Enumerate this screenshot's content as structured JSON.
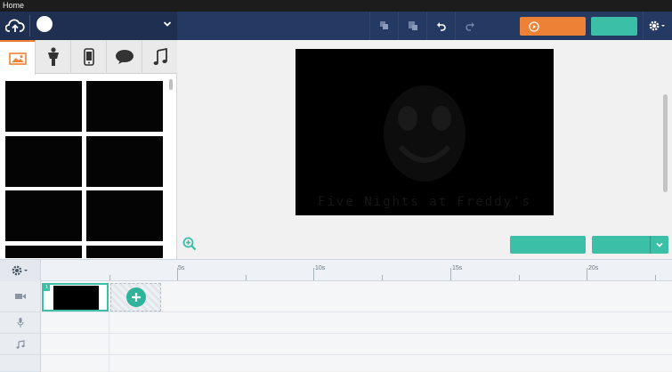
{
  "window": {
    "title": "Home"
  },
  "colors": {
    "navbar": "#253a63",
    "accent_orange": "#ed8136",
    "accent_teal": "#3bbfa7",
    "stage_bg": "#000000"
  },
  "navbar": {
    "upload_icon": "cloud-upload-icon",
    "tools": [
      {
        "name": "copy-icon"
      },
      {
        "name": "paste-icon"
      },
      {
        "name": "undo-icon"
      },
      {
        "name": "redo-icon"
      }
    ],
    "preview_label": "",
    "publish_label": "",
    "settings_icon": "gear-icon"
  },
  "library": {
    "tabs": [
      {
        "name": "image-icon",
        "active": true
      },
      {
        "name": "character-icon",
        "active": false
      },
      {
        "name": "phone-icon",
        "active": false
      },
      {
        "name": "speech-bubble-icon",
        "active": false
      },
      {
        "name": "music-note-icon",
        "active": false
      }
    ]
  },
  "stage": {
    "watermark_text": "Five Nights at Freddy's"
  },
  "timeline": {
    "ruler_labels": [
      "5s",
      "10s",
      "15s",
      "20s"
    ],
    "scene_number": "1",
    "tracks": [
      {
        "name": "video-camera-icon"
      },
      {
        "name": "microphone-icon"
      },
      {
        "name": "music-note-icon"
      }
    ]
  }
}
